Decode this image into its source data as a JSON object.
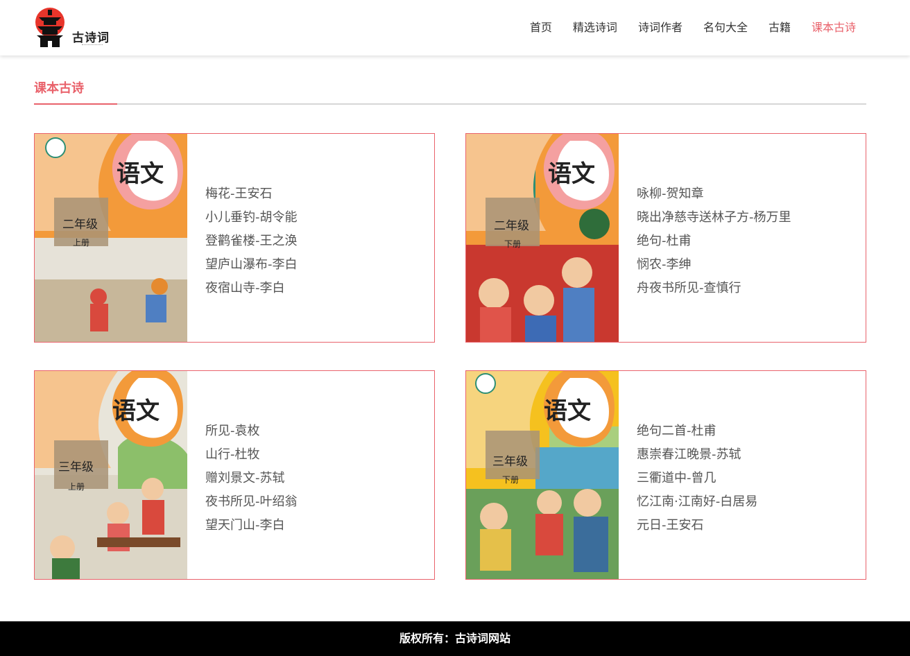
{
  "header": {
    "logo_text": "古诗词",
    "nav": [
      {
        "label": "首页"
      },
      {
        "label": "精选诗词"
      },
      {
        "label": "诗词作者"
      },
      {
        "label": "名句大全"
      },
      {
        "label": "古籍"
      },
      {
        "label": "课本古诗",
        "active": true
      }
    ]
  },
  "colors": {
    "accent": "#e9626b",
    "footer_bg": "#000000"
  },
  "section": {
    "title": "课本古诗"
  },
  "books": [
    {
      "cover": {
        "brand": "语文",
        "grade": "二年级",
        "volume": "上册"
      },
      "poems": [
        "梅花-王安石",
        "小儿垂钓-胡令能",
        "登鹳雀楼-王之涣",
        "望庐山瀑布-李白",
        "夜宿山寺-李白"
      ]
    },
    {
      "cover": {
        "brand": "语文",
        "grade": "二年级",
        "volume": "下册"
      },
      "poems": [
        "咏柳-贺知章",
        "晓出净慈寺送林子方-杨万里",
        "绝句-杜甫",
        "悯农-李绅",
        "舟夜书所见-查慎行"
      ]
    },
    {
      "cover": {
        "brand": "语文",
        "grade": "三年级",
        "volume": "上册"
      },
      "poems": [
        "所见-袁枚",
        "山行-杜牧",
        "赠刘景文-苏轼",
        "夜书所见-叶绍翁",
        "望天门山-李白"
      ]
    },
    {
      "cover": {
        "brand": "语文",
        "grade": "三年级",
        "volume": "下册"
      },
      "poems": [
        "绝句二首-杜甫",
        "惠崇春江晚景-苏轼",
        "三衢道中-曾几",
        "忆江南·江南好-白居易",
        "元日-王安石"
      ]
    }
  ],
  "footer": {
    "text": "版权所有：古诗词网站"
  }
}
